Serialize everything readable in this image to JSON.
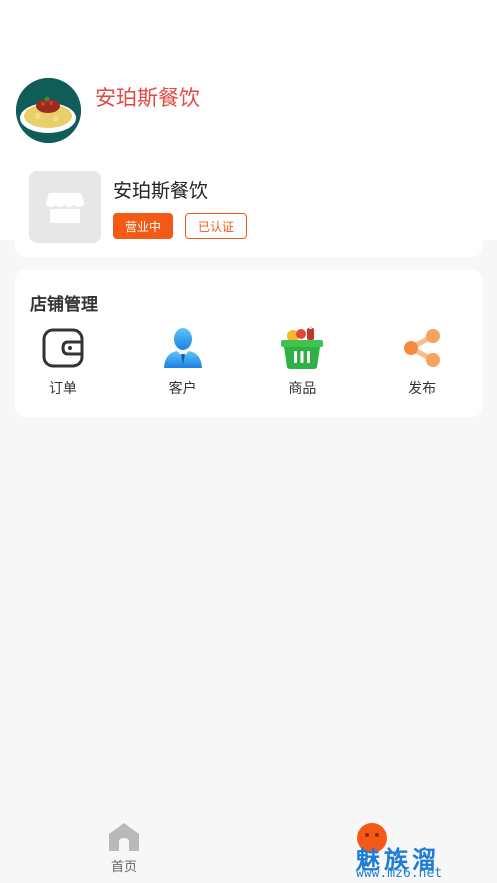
{
  "profile": {
    "shop_title": "安珀斯餐饮"
  },
  "shop_card": {
    "name": "安珀斯餐饮",
    "status_badge": "营业中",
    "verified_badge": "已认证",
    "accent_color": "#f45a16"
  },
  "manage": {
    "title": "店铺管理",
    "items": [
      {
        "label": "订单",
        "icon": "wallet-icon"
      },
      {
        "label": "客户",
        "icon": "user-icon"
      },
      {
        "label": "商品",
        "icon": "basket-icon"
      },
      {
        "label": "发布",
        "icon": "share-icon"
      }
    ]
  },
  "bottom_nav": {
    "home_label": "首页",
    "mine_icon": "smiley-icon"
  },
  "watermark": {
    "text": "魅族溜",
    "url": "www.mz6.net"
  }
}
